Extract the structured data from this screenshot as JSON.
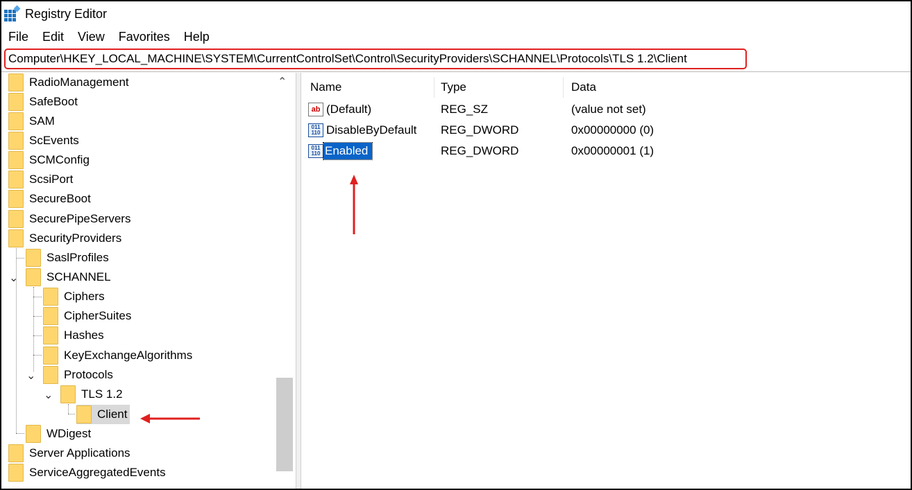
{
  "window": {
    "title": "Registry Editor"
  },
  "menu": [
    "File",
    "Edit",
    "View",
    "Favorites",
    "Help"
  ],
  "address": {
    "path": "Computer\\HKEY_LOCAL_MACHINE\\SYSTEM\\CurrentControlSet\\Control\\SecurityProviders\\SCHANNEL\\Protocols\\TLS 1.2\\Client"
  },
  "tree": {
    "items": [
      {
        "label": "RadioManagement"
      },
      {
        "label": "SafeBoot"
      },
      {
        "label": "SAM"
      },
      {
        "label": "ScEvents"
      },
      {
        "label": "SCMConfig"
      },
      {
        "label": "ScsiPort"
      },
      {
        "label": "SecureBoot"
      },
      {
        "label": "SecurePipeServers"
      },
      {
        "label": "SecurityProviders"
      },
      {
        "label": "SaslProfiles"
      },
      {
        "label": "SCHANNEL"
      },
      {
        "label": "Ciphers"
      },
      {
        "label": "CipherSuites"
      },
      {
        "label": "Hashes"
      },
      {
        "label": "KeyExchangeAlgorithms"
      },
      {
        "label": "Protocols"
      },
      {
        "label": "TLS 1.2"
      },
      {
        "label": "Client"
      },
      {
        "label": "WDigest"
      },
      {
        "label": "Server Applications"
      },
      {
        "label": "ServiceAggregatedEvents"
      }
    ],
    "selected": "Client"
  },
  "list": {
    "columns": [
      "Name",
      "Type",
      "Data"
    ],
    "rows": [
      {
        "name": "(Default)",
        "type": "REG_SZ",
        "data": "(value not set)",
        "icon": "string-value-icon"
      },
      {
        "name": "DisableByDefault",
        "type": "REG_DWORD",
        "data": "0x00000000 (0)",
        "icon": "dword-value-icon"
      },
      {
        "name": "Enabled",
        "type": "REG_DWORD",
        "data": "0x00000001 (1)",
        "icon": "dword-value-icon",
        "selected": true
      }
    ]
  },
  "colors": {
    "annotation": "#e02020",
    "selection": "#0a64c8",
    "folder": "#ffd66e"
  }
}
